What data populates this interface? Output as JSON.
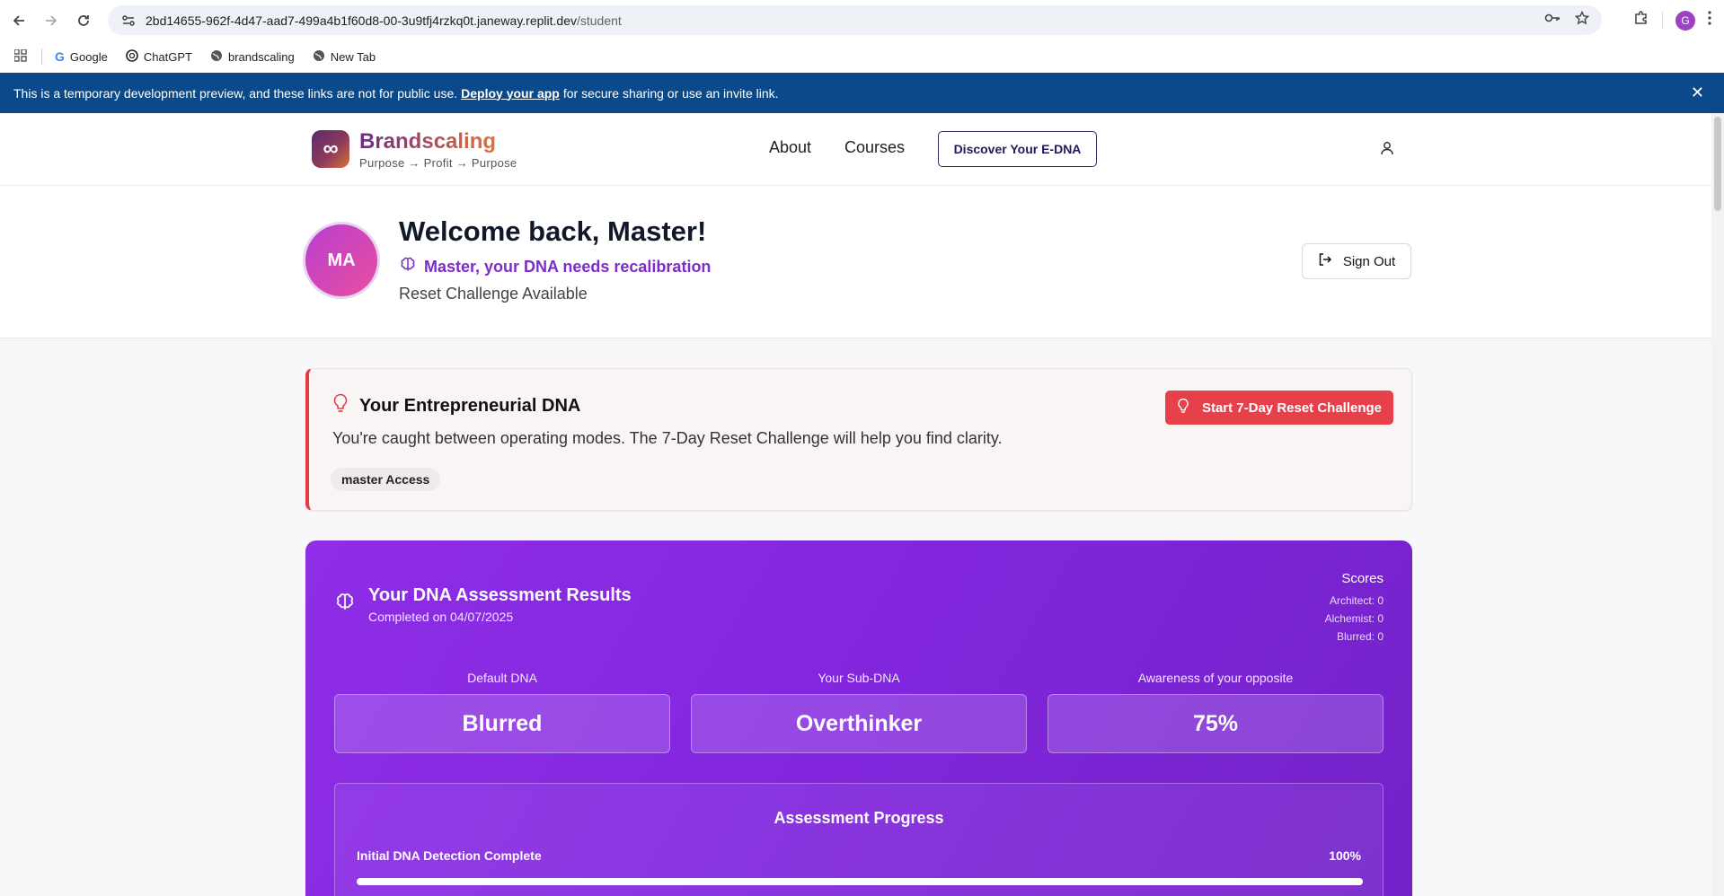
{
  "browser": {
    "url_host": "2bd14655-962f-4d47-aad7-499a4b1f60d8-00-3u9tfj4rzkq0t.janeway.replit.dev",
    "url_path": "/student",
    "profile_initial": "G",
    "bookmarks": [
      {
        "label": "Google"
      },
      {
        "label": "ChatGPT"
      },
      {
        "label": "brandscaling"
      },
      {
        "label": "New Tab"
      }
    ]
  },
  "dev_banner": {
    "text_before": "This is a temporary development preview, and these links are not for public use.",
    "link": "Deploy your app",
    "text_after": "for secure sharing or use an invite link."
  },
  "header": {
    "logo_glyph": "∞",
    "brand": "Brandscaling",
    "tagline": "Purpose → Profit → Purpose",
    "nav": {
      "about": "About",
      "courses": "Courses"
    },
    "cta": "Discover Your E-DNA"
  },
  "welcome": {
    "avatar_initials": "MA",
    "title": "Welcome back, Master!",
    "recalibration": "Master, your DNA needs recalibration",
    "status": "Reset Challenge Available",
    "sign_out": "Sign Out"
  },
  "edna": {
    "title": "Your Entrepreneurial DNA",
    "description": "You're caught between operating modes. The 7-Day Reset Challenge will help you find clarity.",
    "access_badge": "master Access",
    "reset_button": "Start 7-Day Reset Challenge",
    "accent_color": "#e8404a"
  },
  "assessment": {
    "title": "Your DNA Assessment Results",
    "completed": "Completed on 04/07/2025",
    "scores_title": "Scores",
    "scores": [
      "Architect: 0",
      "Alchemist: 0",
      "Blurred: 0"
    ],
    "metrics": [
      {
        "label": "Default DNA",
        "value": "Blurred"
      },
      {
        "label": "Your Sub-DNA",
        "value": "Overthinker"
      },
      {
        "label": "Awareness of your opposite",
        "value": "75%"
      }
    ],
    "progress": {
      "title": "Assessment Progress",
      "label": "Initial DNA Detection Complete",
      "percent_text": "100%",
      "percent": 100
    }
  }
}
